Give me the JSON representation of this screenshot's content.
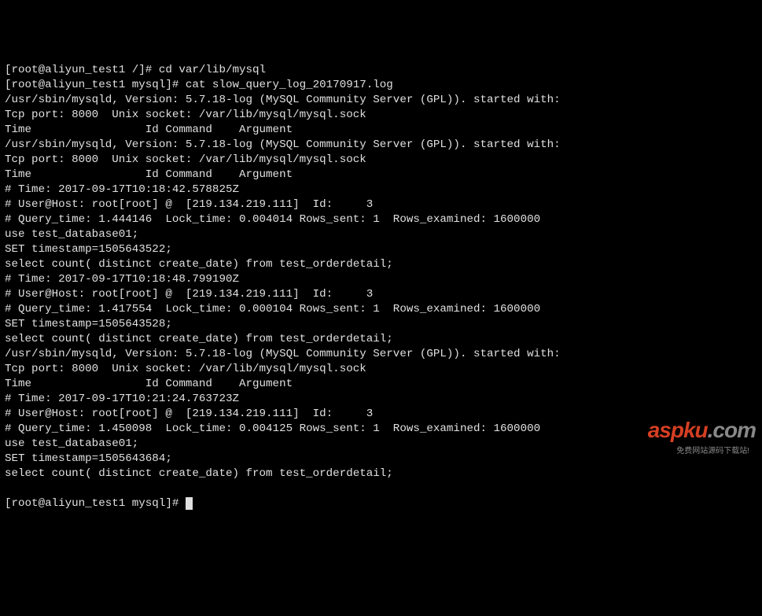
{
  "lines": [
    "[root@aliyun_test1 /]# cd var/lib/mysql",
    "[root@aliyun_test1 mysql]# cat slow_query_log_20170917.log",
    "/usr/sbin/mysqld, Version: 5.7.18-log (MySQL Community Server (GPL)). started with:",
    "Tcp port: 8000  Unix socket: /var/lib/mysql/mysql.sock",
    "Time                 Id Command    Argument",
    "/usr/sbin/mysqld, Version: 5.7.18-log (MySQL Community Server (GPL)). started with:",
    "Tcp port: 8000  Unix socket: /var/lib/mysql/mysql.sock",
    "Time                 Id Command    Argument",
    "# Time: 2017-09-17T10:18:42.578825Z",
    "# User@Host: root[root] @  [219.134.219.111]  Id:     3",
    "# Query_time: 1.444146  Lock_time: 0.004014 Rows_sent: 1  Rows_examined: 1600000",
    "use test_database01;",
    "SET timestamp=1505643522;",
    "select count( distinct create_date) from test_orderdetail;",
    "# Time: 2017-09-17T10:18:48.799190Z",
    "# User@Host: root[root] @  [219.134.219.111]  Id:     3",
    "# Query_time: 1.417554  Lock_time: 0.000104 Rows_sent: 1  Rows_examined: 1600000",
    "SET timestamp=1505643528;",
    "select count( distinct create_date) from test_orderdetail;",
    "/usr/sbin/mysqld, Version: 5.7.18-log (MySQL Community Server (GPL)). started with:",
    "Tcp port: 8000  Unix socket: /var/lib/mysql/mysql.sock",
    "Time                 Id Command    Argument",
    "# Time: 2017-09-17T10:21:24.763723Z",
    "# User@Host: root[root] @  [219.134.219.111]  Id:     3",
    "# Query_time: 1.450098  Lock_time: 0.004125 Rows_sent: 1  Rows_examined: 1600000",
    "use test_database01;",
    "SET timestamp=1505643684;",
    "select count( distinct create_date) from test_orderdetail;"
  ],
  "prompt_final": "[root@aliyun_test1 mysql]# ",
  "watermark": {
    "red": "aspku",
    "grey": ".com",
    "sub": "免费网站源码下载站!"
  }
}
